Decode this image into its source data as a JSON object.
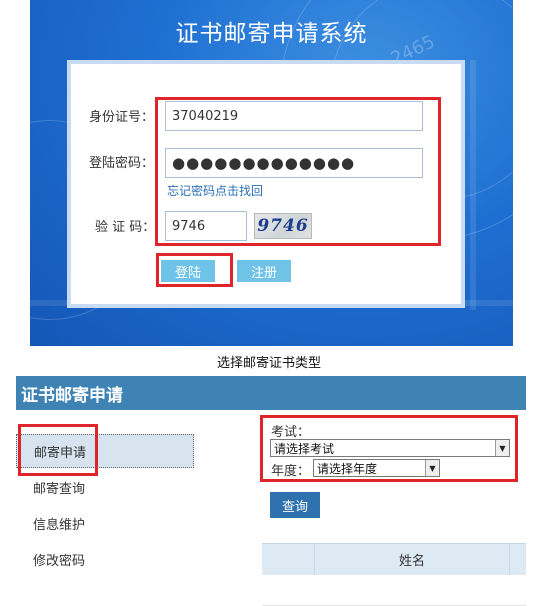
{
  "login": {
    "title": "证书邮寄申请系统",
    "id_label": "身份证号：",
    "id_value": "37040219",
    "password_label": "登陆密码：",
    "password_value": "●●●●●●●●●●●●●",
    "forgot_link": "忘记密码点击找回",
    "captcha_label": "验 证 码：",
    "captcha_value": "9746",
    "captcha_image_text": "9746",
    "login_button": "登陆",
    "register_button": "注册",
    "watermark": "2465"
  },
  "caption": "选择邮寄证书类型",
  "app": {
    "title": "证书邮寄申请",
    "nav": [
      {
        "label": "邮寄申请",
        "active": true
      },
      {
        "label": "邮寄查询",
        "active": false
      },
      {
        "label": "信息维护",
        "active": false
      },
      {
        "label": "修改密码",
        "active": false
      }
    ],
    "exam_label": "考试：",
    "exam_select": "请选择考试",
    "year_label": "年度：",
    "year_select": "请选择年度",
    "query_button": "查询",
    "table": {
      "columns": [
        "姓名"
      ]
    }
  },
  "colors": {
    "accent": "#3f83b5",
    "highlight": "#e0242b",
    "banner": "#1f6fd2"
  }
}
